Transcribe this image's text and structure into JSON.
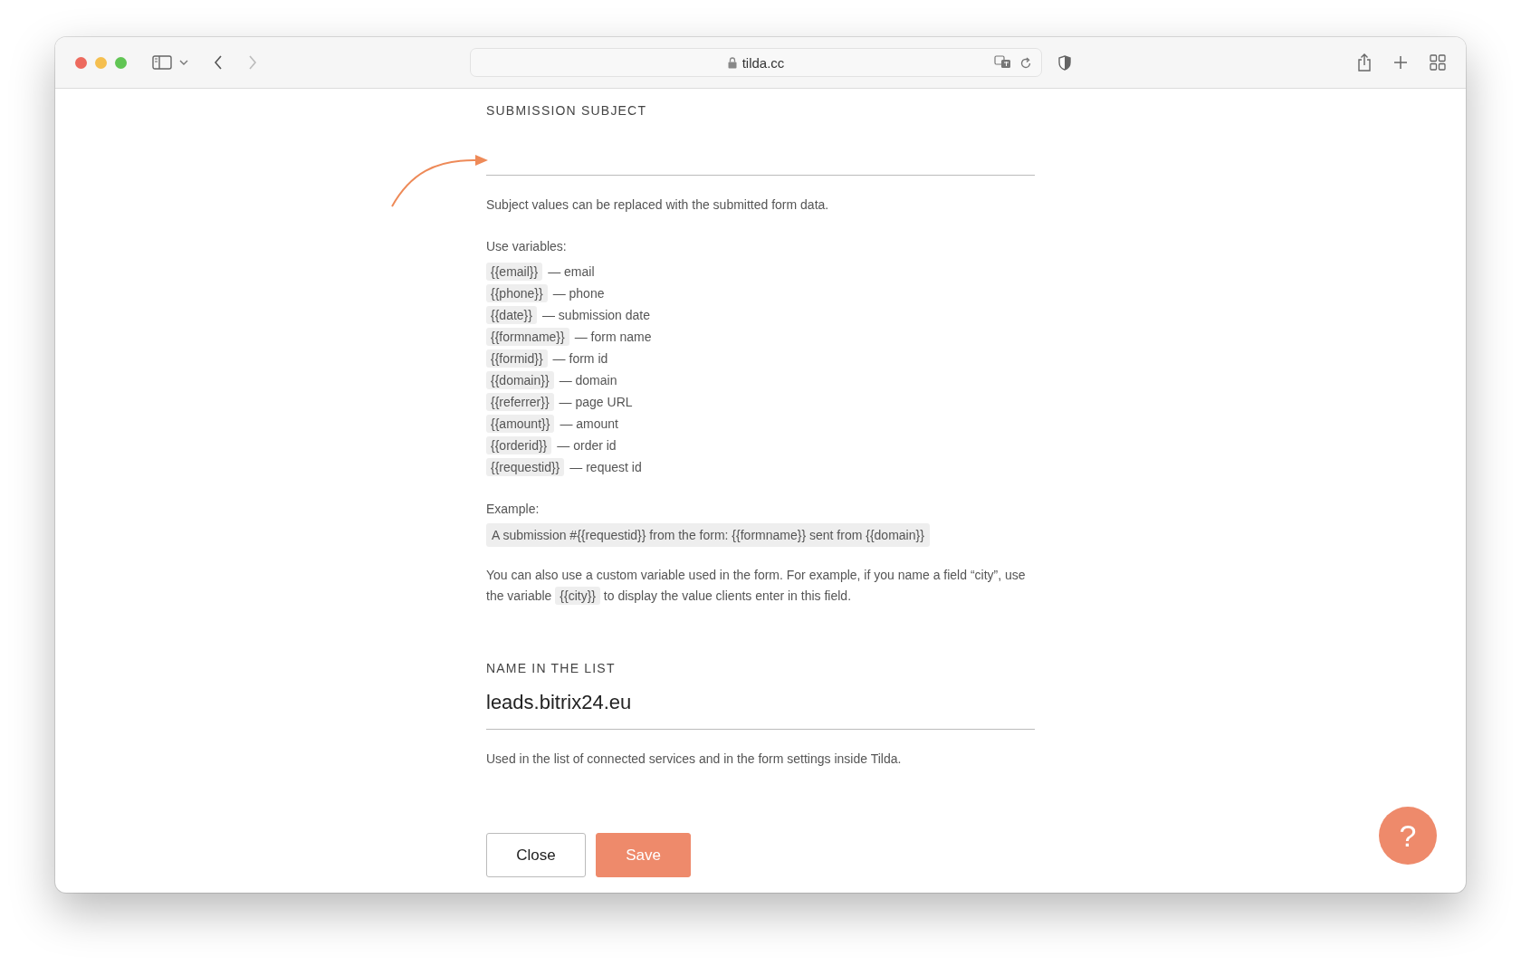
{
  "toolbar": {
    "nav_buttons": [
      {
        "kind": "back",
        "disabled": false
      },
      {
        "kind": "forward",
        "disabled": true
      }
    ],
    "address": "tilda.cc"
  },
  "subject_section": {
    "label": "SUBMISSION SUBJECT",
    "help": "Subject values can be replaced with the submitted form data.",
    "variables_label": "Use variables:",
    "variables": [
      {
        "code": "{{email}}",
        "description": "— email"
      },
      {
        "code": "{{phone}}",
        "description": "— phone"
      },
      {
        "code": "{{date}}",
        "description": "— submission date"
      },
      {
        "code": "{{formname}}",
        "description": "— form name"
      },
      {
        "code": "{{formid}}",
        "description": "— form id"
      },
      {
        "code": "{{domain}}",
        "description": "— domain"
      },
      {
        "code": "{{referrer}}",
        "description": "— page URL"
      },
      {
        "code": "{{amount}}",
        "description": "— amount"
      },
      {
        "code": "{{orderid}}",
        "description": "— order id"
      },
      {
        "code": "{{requestid}}",
        "description": "— request id"
      }
    ],
    "example_label": "Example:",
    "example": "A submission #{{requestid}} from the form: {{formname}} sent from {{domain}}",
    "custom_note": {
      "before": "You can also use a custom variable used in the form. For example, if you name a field “city”, use the variable",
      "code": "{{city}}",
      "after": "to display the value clients enter in this field."
    }
  },
  "name_section": {
    "label": "NAME IN THE LIST",
    "value": "leads.bitrix24.eu",
    "help": "Used in the list of connected services and in the form settings inside Tilda."
  },
  "buttons": [
    {
      "kind": "secondary",
      "label": "Close"
    },
    {
      "kind": "primary",
      "label": "Save"
    }
  ],
  "help_button": {
    "label": "?"
  }
}
